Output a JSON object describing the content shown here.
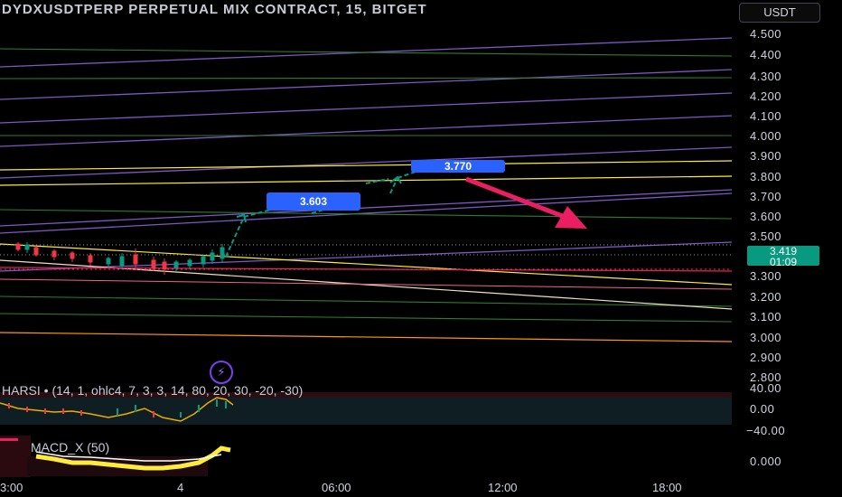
{
  "header": {
    "title": "DYDXUSDTPERP PERPETUAL MIX CONTRACT, 15, BITGET",
    "currency_button": "USDT"
  },
  "price_axis": {
    "ticks": [
      "4.500",
      "4.400",
      "4.300",
      "4.200",
      "4.100",
      "4.000",
      "3.900",
      "3.800",
      "3.700",
      "3.600",
      "3.500",
      "3.300",
      "3.200",
      "3.100",
      "3.000",
      "2.900",
      "2.800"
    ],
    "current_price": "3.419",
    "countdown": "01:09"
  },
  "callouts": {
    "first": "3.603",
    "second": "3.770"
  },
  "harsi": {
    "title": "HARSI • (14, 1, ohlc4, 7, 3, 3, 14, 80, 20, 30, -20, -30)",
    "ticks": [
      "40.00",
      "0.00",
      "−40.00"
    ]
  },
  "macd": {
    "title": "MACD_X (50)",
    "ticks": [
      "0.000"
    ]
  },
  "time_axis": {
    "labels": [
      "3:00",
      "4",
      "06:00",
      "12:00",
      "18:00"
    ]
  },
  "colors": {
    "up": "#089981",
    "down": "#f23645",
    "accent_blue": "#2962ff",
    "arrow": "#e91e63",
    "purple_line": "#7e57c2",
    "green_line": "#2e7d32",
    "yellow_line": "#ffeb3b"
  },
  "icons": {
    "indicator": "lightning-bolt-icon"
  }
}
